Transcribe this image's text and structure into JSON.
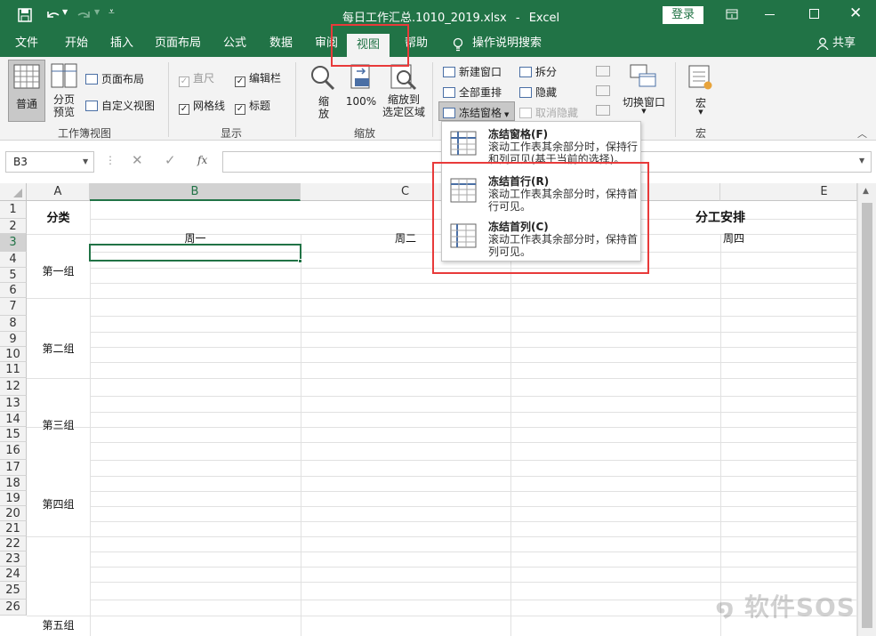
{
  "titlebar": {
    "filename": "每日工作汇总.1010_2019.xlsx",
    "separator": "-",
    "app": "Excel",
    "login": "登录"
  },
  "tabs": [
    "文件",
    "开始",
    "插入",
    "页面布局",
    "公式",
    "数据",
    "审阅",
    "视图",
    "帮助"
  ],
  "active_tab": "视图",
  "tell_me": "操作说明搜索",
  "share": "共享",
  "ribbon": {
    "workbook_views": {
      "normal": "普通",
      "page_break": "分页\n预览",
      "page_layout": "页面布局",
      "custom_views": "自定义视图",
      "label": "工作簿视图"
    },
    "show": {
      "ruler": "直尺",
      "formula_bar": "编辑栏",
      "gridlines": "网格线",
      "headings": "标题",
      "label": "显示"
    },
    "zoom": {
      "zoom": "缩\n放",
      "zoom100": "100%",
      "zoom_selection": "缩放到\n选定区域",
      "label": "缩放"
    },
    "window": {
      "new_window": "新建窗口",
      "arrange_all": "全部重排",
      "freeze_panes": "冻结窗格",
      "split": "拆分",
      "hide": "隐藏",
      "unhide": "取消隐藏",
      "switch_windows": "切换窗口"
    },
    "macros": {
      "macros": "宏",
      "label": "宏"
    }
  },
  "formula": {
    "namebox": "B3",
    "fx": "fx",
    "value": ""
  },
  "columns": [
    "A",
    "B",
    "C",
    "E"
  ],
  "rows": [
    "1",
    "2",
    "3",
    "4",
    "5",
    "6",
    "7",
    "8",
    "9",
    "10",
    "11",
    "12",
    "13",
    "14",
    "15",
    "16",
    "17",
    "18",
    "19",
    "20",
    "21",
    "22",
    "23",
    "24",
    "25",
    "26"
  ],
  "cells": {
    "a1": "分类",
    "b2": "周一",
    "c2": "周二",
    "e2": "周四",
    "title": "分工安排",
    "groups": [
      "第一组",
      "第二组",
      "第三组",
      "第四组",
      "第五组"
    ]
  },
  "dropdown": [
    {
      "title": "冻结窗格(F)",
      "desc": "滚动工作表其余部分时，保持行和列可见(基于当前的选择)。"
    },
    {
      "title": "冻结首行(R)",
      "desc": "滚动工作表其余部分时，保持首行可见。"
    },
    {
      "title": "冻结首列(C)",
      "desc": "滚动工作表其余部分时，保持首列可见。"
    }
  ],
  "watermark": "软件SOS",
  "colors": {
    "excel_green": "#217346",
    "highlight_red": "#e83a3a",
    "ribbon_bg": "#f3f3f3"
  }
}
